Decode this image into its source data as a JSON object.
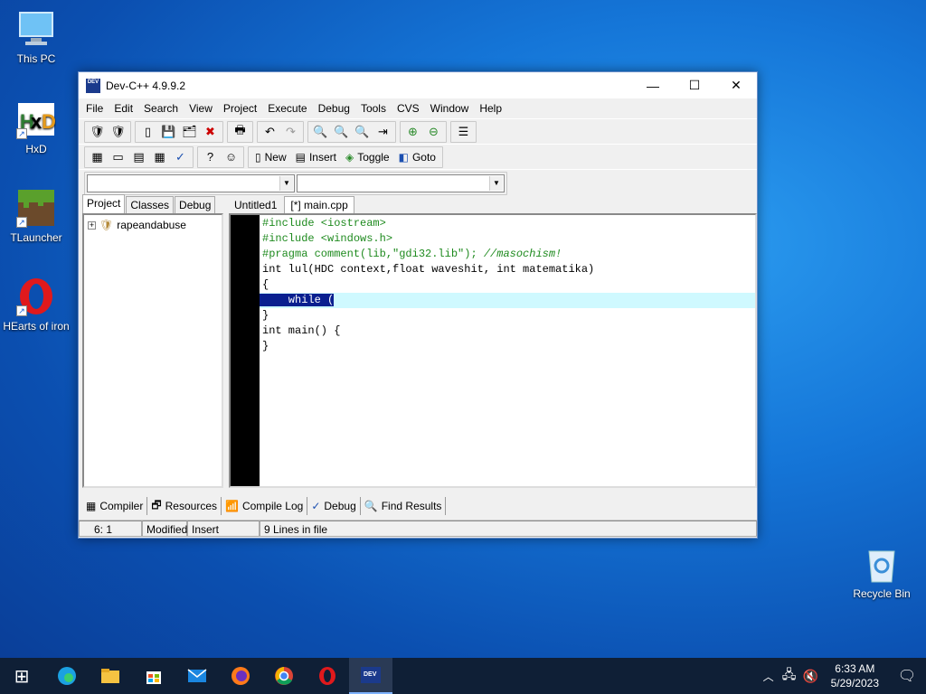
{
  "desktop": {
    "icons": [
      {
        "label": "This PC",
        "icon": "computer-icon"
      },
      {
        "label": "HxD",
        "icon": "hxd-icon"
      },
      {
        "label": "TLauncher",
        "icon": "minecraft-icon"
      },
      {
        "label": "HEarts of iron",
        "icon": "opera-icon"
      },
      {
        "label": "Recycle Bin",
        "icon": "recycle-bin-icon"
      }
    ]
  },
  "window": {
    "title": "Dev-C++ 4.9.9.2",
    "app_icon_text": "DEV",
    "menu": [
      "File",
      "Edit",
      "Search",
      "View",
      "Project",
      "Execute",
      "Debug",
      "Tools",
      "CVS",
      "Window",
      "Help"
    ],
    "toolbar": {
      "new_label": "New",
      "insert_label": "Insert",
      "toggle_label": "Toggle",
      "goto_label": "Goto"
    },
    "left_tabs": [
      "Project",
      "Classes",
      "Debug"
    ],
    "project_tree": {
      "root": "rapeandabuse"
    },
    "editor_tabs": [
      "Untitled1",
      "[*] main.cpp"
    ],
    "code_lines": [
      {
        "kind": "pp",
        "text": "#include <iostream>"
      },
      {
        "kind": "pp",
        "text": "#include <windows.h>"
      },
      {
        "kind": "pragma",
        "text": "#pragma comment(lib,\"gdi32.lib\"); ",
        "comment": "//masochism!"
      },
      {
        "kind": "plain",
        "text": "int lul(HDC context,float waveshit, int matematika)"
      },
      {
        "kind": "plain",
        "text": "{"
      },
      {
        "kind": "sel",
        "text": "    while ("
      },
      {
        "kind": "plain",
        "text": "}"
      },
      {
        "kind": "plain",
        "text": "int main() {"
      },
      {
        "kind": "plain",
        "text": "}"
      }
    ],
    "bottom_tabs": [
      {
        "label": "Compiler",
        "icon": "compiler-icon"
      },
      {
        "label": "Resources",
        "icon": "resources-icon"
      },
      {
        "label": "Compile Log",
        "icon": "compile-log-icon"
      },
      {
        "label": "Debug",
        "icon": "debug-check-icon"
      },
      {
        "label": "Find Results",
        "icon": "find-results-icon"
      }
    ],
    "status": {
      "position": "6: 1",
      "modified": "Modified",
      "mode": "Insert",
      "lines": "9 Lines in file"
    }
  },
  "taskbar": {
    "time": "6:33 AM",
    "date": "5/29/2023",
    "apps": [
      "start-icon",
      "edge-icon",
      "file-explorer-icon",
      "store-icon",
      "mail-icon",
      "firefox-icon",
      "chrome-icon",
      "opera-icon",
      "devcpp-icon"
    ]
  }
}
